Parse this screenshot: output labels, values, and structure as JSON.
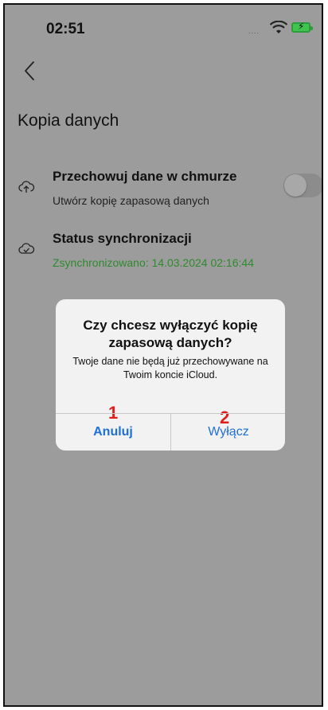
{
  "status_bar": {
    "time": "02:51",
    "signal_text": "....",
    "icons": [
      "wifi-icon",
      "battery-charging-icon"
    ]
  },
  "nav": {
    "back_icon": "chevron-left-icon"
  },
  "page": {
    "title": "Kopia danych"
  },
  "settings": {
    "cloud_backup": {
      "icon": "cloud-upload-icon",
      "title": "Przechowuj dane w chmurze",
      "subtitle": "Utwórz kopię zapasową danych",
      "toggle_state": "off"
    },
    "sync_status": {
      "icon": "cloud-check-icon",
      "title": "Status synchronizacji",
      "value": "Zsynchronizowano: 14.03.2024 02:16:44"
    }
  },
  "dialog": {
    "title": "Czy chcesz wyłączyć kopię zapasową danych?",
    "message": "Twoje dane nie będą już przechowywane na Twoim koncie iCloud.",
    "cancel_label": "Anuluj",
    "confirm_label": "Wyłącz",
    "marker_cancel": "1",
    "marker_confirm": "2"
  },
  "colors": {
    "accent_blue": "#1e6fd9",
    "sync_green": "#2f8a2f",
    "marker_red": "#e01e1e",
    "overlay_gray": "#9c9c9c"
  }
}
